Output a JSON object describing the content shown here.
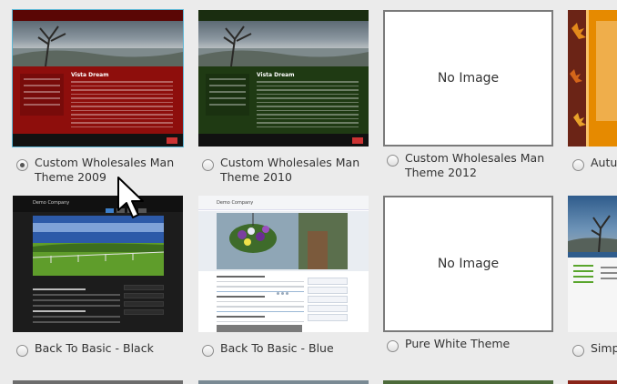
{
  "themes": [
    {
      "label": "Custom Wholesales Man Theme 2009",
      "selected": true,
      "preview": {
        "title": "Vista Dream",
        "color": "#8e0e0c"
      }
    },
    {
      "label": "Custom Wholesales Man Theme 2010",
      "selected": false,
      "preview": {
        "title": "Vista Dream",
        "color": "#1f3a13"
      }
    },
    {
      "label": "Custom Wholesales Man Theme 2012",
      "selected": false,
      "preview": {
        "no_image": "No Image"
      }
    },
    {
      "label": "Autum",
      "selected": false
    },
    {
      "label": "Back To Basic - Black",
      "selected": false,
      "preview": {
        "company": "Demo Company"
      }
    },
    {
      "label": "Back To Basic - Blue",
      "selected": false,
      "preview": {
        "company": "Demo Company"
      }
    },
    {
      "label": "Pure White Theme",
      "selected": false,
      "preview": {
        "no_image": "No Image"
      }
    },
    {
      "label": "Simply",
      "selected": false
    }
  ],
  "colors": {
    "selection_outline": "#5fb8d6",
    "page_background": "#ebebeb"
  }
}
